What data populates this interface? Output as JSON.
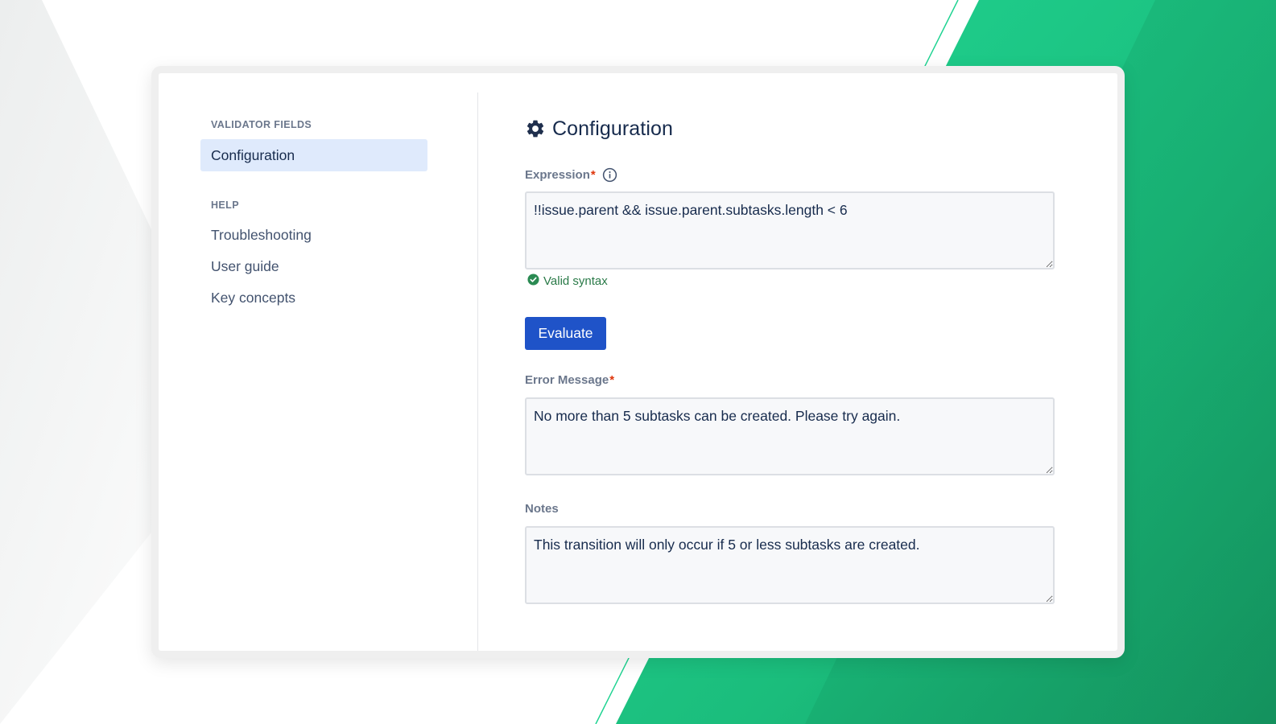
{
  "colors": {
    "accent_green": "#1ec98a",
    "primary_button": "#1f53c8",
    "active_nav_bg": "#dfeafc",
    "valid_green": "#2a7a48",
    "required_red": "#de350b"
  },
  "sidebar": {
    "sections": [
      {
        "heading": "VALIDATOR FIELDS",
        "items": [
          {
            "label": "Configuration",
            "active": true
          }
        ]
      },
      {
        "heading": "HELP",
        "items": [
          {
            "label": "Troubleshooting",
            "active": false
          },
          {
            "label": "User guide",
            "active": false
          },
          {
            "label": "Key concepts",
            "active": false
          }
        ]
      }
    ]
  },
  "main": {
    "title": "Configuration",
    "title_icon": "gear-icon",
    "expression": {
      "label": "Expression",
      "required_mark": "*",
      "info_icon": "info-icon",
      "value": "!!issue.parent && issue.parent.subtasks.length < 6",
      "validation_icon": "check-circle-icon",
      "validation_text": "Valid syntax"
    },
    "evaluate_button": {
      "label": "Evaluate"
    },
    "error_message": {
      "label": "Error Message",
      "required_mark": "*",
      "value": "No more than 5 subtasks can be created. Please try again."
    },
    "notes": {
      "label": "Notes",
      "value": "This transition will only occur if 5 or less subtasks are created."
    }
  }
}
